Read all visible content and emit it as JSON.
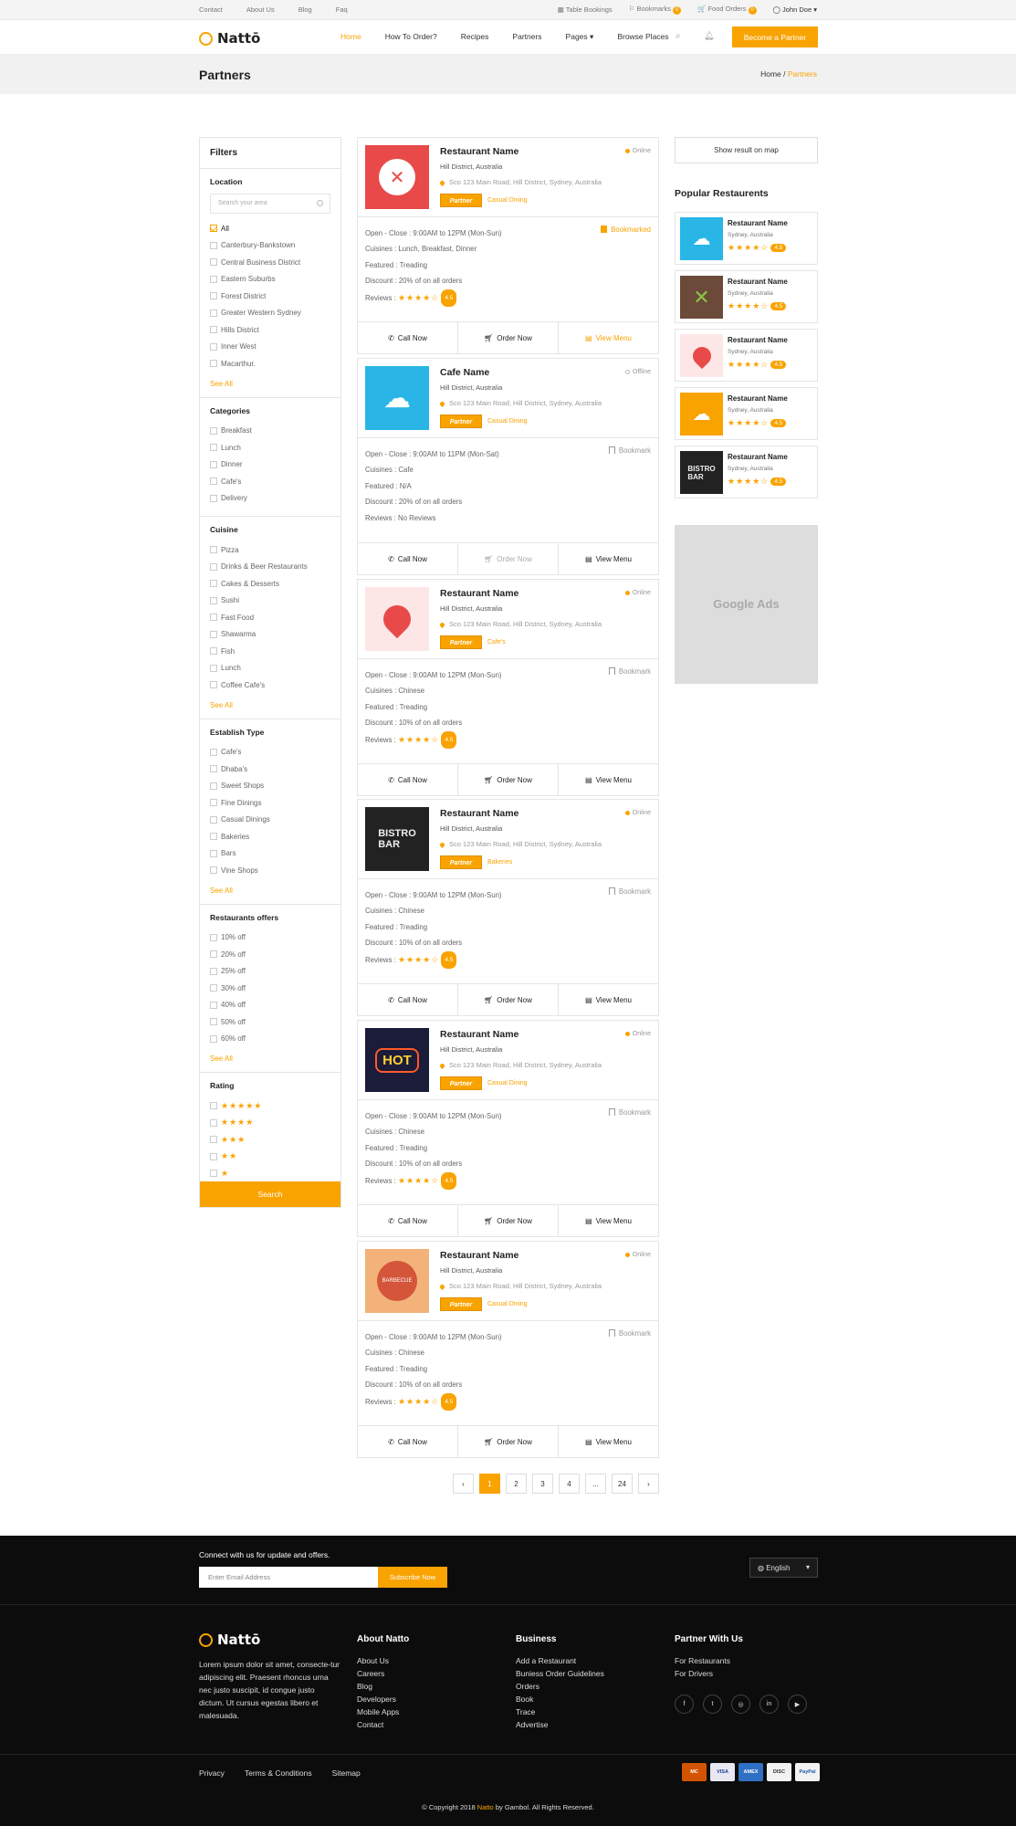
{
  "topbar": {
    "links": [
      "Contact",
      "About Us",
      "Blog",
      "Faq"
    ],
    "table_bookings": "Table Bookings",
    "bookmarks": "Bookmarks",
    "bookmarks_count": "0",
    "food_orders": "Food Orders",
    "food_orders_count": "0",
    "user": "John Doe"
  },
  "brand": {
    "name": "Nattō",
    "accent": "#f9a300"
  },
  "nav": {
    "items": [
      "Home",
      "How To Order?",
      "Recipes",
      "Partners",
      "Pages",
      "Browse Places"
    ],
    "cta": "Become a Partner"
  },
  "page": {
    "title": "Partners",
    "breadcrumb_home": "Home",
    "breadcrumb_current": "Partners"
  },
  "filters": {
    "title": "Filters",
    "search_placeholder": "Search your area",
    "location_title": "Location",
    "location": [
      "All",
      "Canterbury-Bankstown",
      "Central Business District",
      "Eastern Suburbs",
      "Forest District",
      "Greater Western Sydney",
      "Hills District",
      "Inner West",
      "Macarthur."
    ],
    "categories_title": "Categories",
    "categories": [
      "Breakfast",
      "Lunch",
      "Dinner",
      "Cafe's",
      "Delivery"
    ],
    "cuisine_title": "Cuisine",
    "cuisine": [
      "Pizza",
      "Drinks & Beer Restaurants",
      "Cakes & Desserts",
      "Sushi",
      "Fast Food",
      "Shawarma",
      "Fish",
      "Lunch",
      "Coffee Cafe's"
    ],
    "establish_title": "Establish Type",
    "establish": [
      "Cafe's",
      "Dhaba's",
      "Sweet Shops",
      "Fine Dinings",
      "Casual Dinings",
      "Bakeries",
      "Bars",
      "Vine Shops"
    ],
    "offers_title": "Restaurants offers",
    "offers": [
      "10% off",
      "20% off",
      "25% off",
      "30% off",
      "40% off",
      "50% off",
      "60% off"
    ],
    "rating_title": "Rating",
    "see_all": "See All",
    "search_button": "Search"
  },
  "cards": [
    {
      "name": "Restaurant Name",
      "location": "Hill District, Australia",
      "address": "Sco 123 Main Road, Hill District, Sydney, Australia",
      "badge": "Partner",
      "category": "Casual Dining",
      "status": "Online",
      "hours": "Open - Close : 9:00AM to 12PM (Mon-Sun)",
      "cuisines": "Cuisines : Lunch, Breakfast, Dinner",
      "featured": "Featured : Treading",
      "discount": "Discount : 20% of on all orders",
      "reviews_label": "Reviews :",
      "rating": "4.5",
      "bookmark": "Bookmarked",
      "call": "Call Now",
      "order": "Order Now",
      "menu": "View Menu"
    },
    {
      "name": "Cafe Name",
      "location": "Hill District, Australia",
      "address": "Sco 123 Main Road, Hill District, Sydney, Australia",
      "badge": "Partner",
      "category": "Casual Dining",
      "status": "Offline",
      "hours": "Open - Close : 9:00AM to 11PM (Mon-Sat)",
      "cuisines": "Cuisines : Cafe",
      "featured": "Featured : N/A",
      "discount": "Discount : 20% of on all orders",
      "reviews_label": "Reviews : No Reviews",
      "rating": "",
      "bookmark": "Bookmark",
      "call": "Call Now",
      "order": "Order Now",
      "menu": "View Menu"
    },
    {
      "name": "Restaurant Name",
      "location": "Hill District, Australia",
      "address": "Sco 123 Main Road, Hill District, Sydney, Australia",
      "badge": "Partner",
      "category": "Cafe's",
      "status": "Online",
      "hours": "Open - Close : 9:00AM to 12PM (Mon-Sun)",
      "cuisines": "Cuisines : Chinese",
      "featured": "Featured : Treading",
      "discount": "Discount : 10% of on all orders",
      "reviews_label": "Reviews :",
      "rating": "4.5",
      "bookmark": "Bookmark",
      "call": "Call Now",
      "order": "Order Now",
      "menu": "View Menu"
    },
    {
      "name": "Restaurant Name",
      "location": "Hill District, Australia",
      "address": "Sco 123 Main Road, Hill District, Sydney, Australia",
      "badge": "Partner",
      "category": "Bakeries",
      "status": "Online",
      "hours": "Open - Close : 9:00AM to 12PM (Mon-Sun)",
      "cuisines": "Cuisines : Chinese",
      "featured": "Featured : Treading",
      "discount": "Discount : 10% of on all orders",
      "reviews_label": "Reviews :",
      "rating": "4.5",
      "bookmark": "Bookmark",
      "call": "Call Now",
      "order": "Order Now",
      "menu": "View Menu"
    },
    {
      "name": "Restaurant Name",
      "location": "Hill District, Australia",
      "address": "Sco 123 Main Road, Hill District, Sydney, Australia",
      "badge": "Partner",
      "category": "Casual Dining",
      "status": "Online",
      "hours": "Open - Close : 9:00AM to 12PM (Mon-Sun)",
      "cuisines": "Cuisines : Chinese",
      "featured": "Featured : Treading",
      "discount": "Discount : 10% of on all orders",
      "reviews_label": "Reviews :",
      "rating": "4.5",
      "bookmark": "Bookmark",
      "call": "Call Now",
      "order": "Order Now",
      "menu": "View Menu"
    },
    {
      "name": "Restaurant Name",
      "location": "Hill District, Australia",
      "address": "Sco 123 Main Road, Hill District, Sydney, Australia",
      "badge": "Partner",
      "category": "Casual Dining",
      "status": "Online",
      "hours": "Open - Close : 9:00AM to 12PM (Mon-Sun)",
      "cuisines": "Cuisines : Chinese",
      "featured": "Featured : Treading",
      "discount": "Discount : 10% of on all orders",
      "reviews_label": "Reviews :",
      "rating": "4.5",
      "bookmark": "Bookmark",
      "call": "Call Now",
      "order": "Order Now",
      "menu": "View Menu"
    }
  ],
  "sidebar": {
    "show_map": "Show result on map",
    "popular_title": "Popular Restaurents",
    "popular": [
      {
        "name": "Restaurant Name",
        "location": "Sydney, Australia",
        "rating": "4.5"
      },
      {
        "name": "Restaurant Name",
        "location": "Sydney, Australia",
        "rating": "4.5"
      },
      {
        "name": "Restaurant Name",
        "location": "Sydney, Australia",
        "rating": "4.5"
      },
      {
        "name": "Restaurant Name",
        "location": "Sydney, Australia",
        "rating": "4.5"
      },
      {
        "name": "Restaurant Name",
        "location": "Sydney, Australia",
        "rating": "4.5"
      }
    ],
    "ads": "Google Ads"
  },
  "pagination": {
    "pages": [
      "1",
      "2",
      "3",
      "4",
      "...",
      "24"
    ],
    "current": "1"
  },
  "footer": {
    "newsletter_title": "Connect with us for update and offers.",
    "email_placeholder": "Enter Email Address",
    "subscribe": "Subscribe Now",
    "language": "English",
    "about_text": "Lorem ipsum dolor sit amet, consecte-tur adipiscing elit. Praesent rhoncus urna nec justo suscipit, id congue justo dictum. Ut cursus egestas libero et malesuada.",
    "about_title": "About Natto",
    "about_links": [
      "About Us",
      "Careers",
      "Blog",
      "Developers",
      "Mobile Apps",
      "Contact"
    ],
    "business_title": "Business",
    "business_links": [
      "Add a Restaurant",
      "Buniess Order Guidelines",
      "Orders",
      "Book",
      "Trace",
      "Advertise"
    ],
    "partner_title": "Partner With Us",
    "partner_links": [
      "For Restaurants",
      "For Drivers"
    ],
    "bottom_links": [
      "Privacy",
      "Terms & Conditions",
      "Sitemap"
    ],
    "payments": [
      "MC",
      "VISA",
      "AMEX",
      "DISC",
      "PayPal"
    ],
    "copyright_pre": "© Copyright 2018",
    "copyright_brand": "Natto",
    "copyright_post": "by Gambol. All Rights Reserved."
  }
}
